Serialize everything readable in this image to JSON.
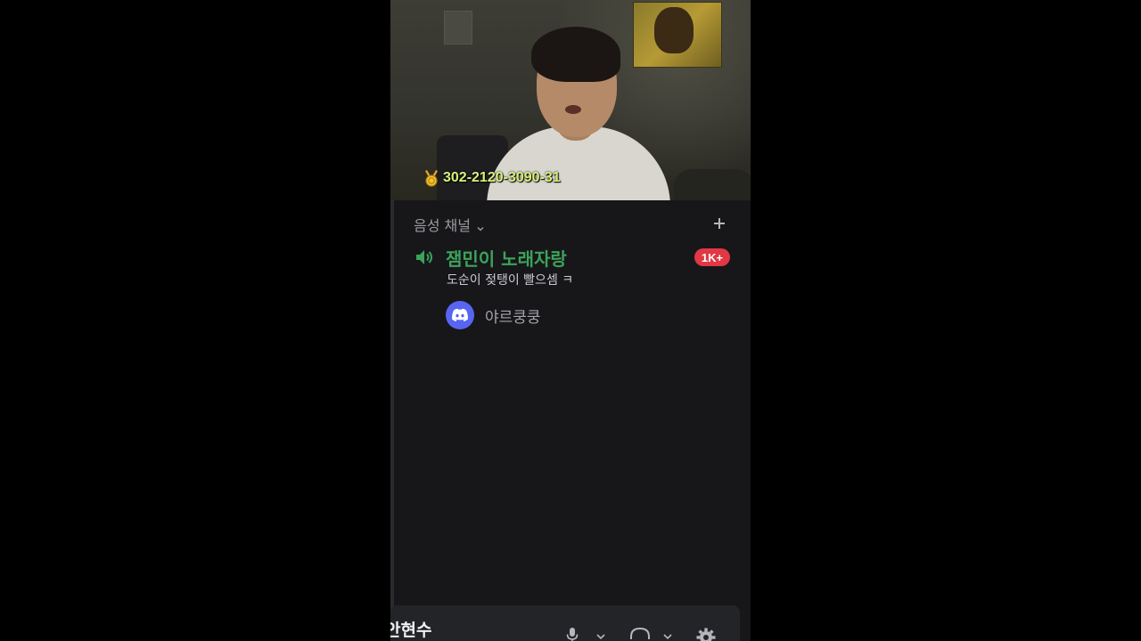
{
  "overlay": {
    "donation_text": "302-2120-3090-31"
  },
  "sidebar": {
    "category_label": "음성 채널",
    "voice_channel": {
      "name": "잼민이 노래자랑",
      "status": "도순이 젖탱이 빨으셈 ㅋ",
      "badge": "1K+"
    },
    "members": [
      {
        "name": "야르쿵쿵"
      }
    ]
  },
  "user_panel": {
    "username": "안현수"
  },
  "colors": {
    "channel_active": "#3ca35b",
    "badge": "#e23744",
    "discord_blurple": "#5865f2",
    "donation_text": "#d8f27a"
  },
  "icons": {
    "medal": "medal-icon",
    "speaker": "speaker-icon",
    "chevron": "chevron-down-icon",
    "add": "plus-icon",
    "avatar": "discord-logo-icon",
    "mic": "microphone-icon",
    "headset": "headset-icon",
    "settings": "gear-icon"
  }
}
